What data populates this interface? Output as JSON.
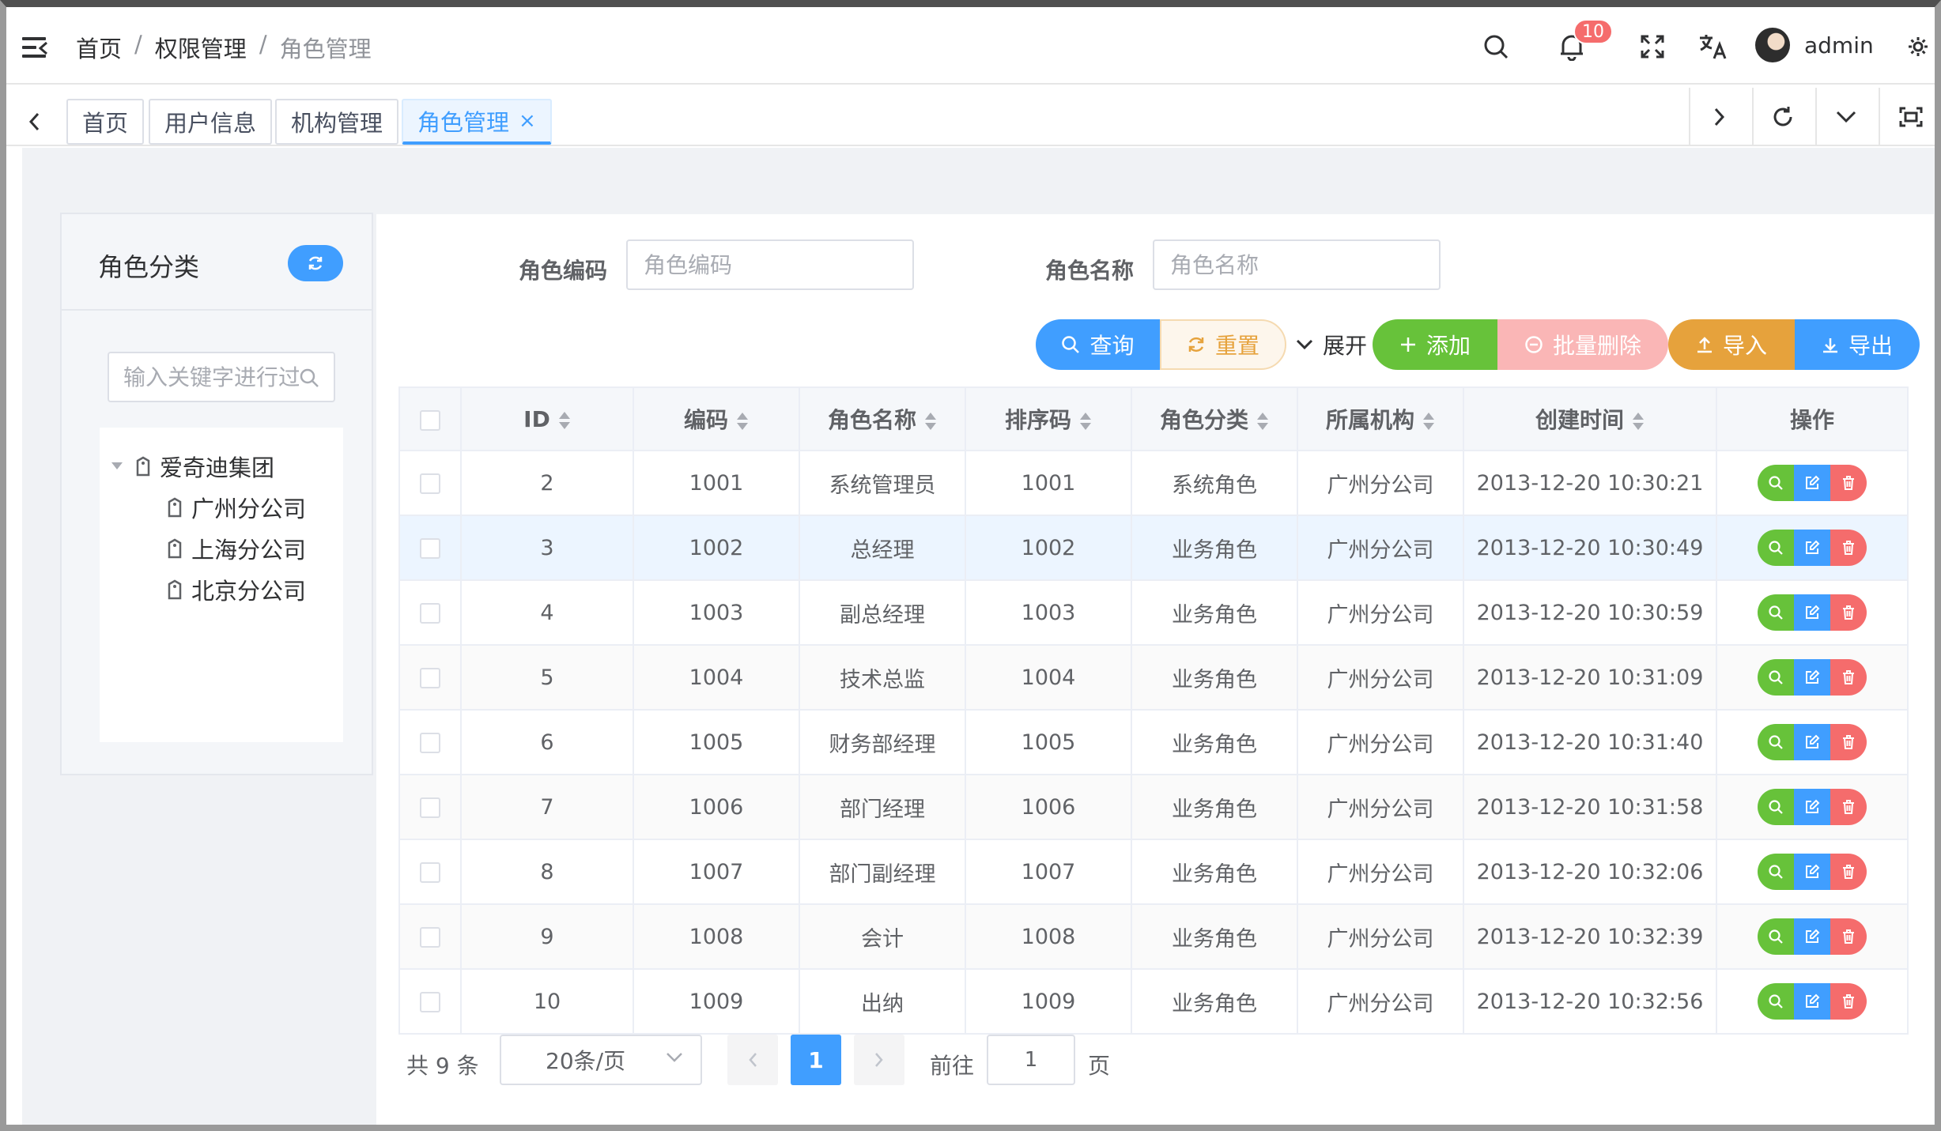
{
  "header": {
    "breadcrumb": [
      "首页",
      "权限管理",
      "角色管理"
    ],
    "breadcrumb_sep": "/",
    "notification_count": "10",
    "username": "admin"
  },
  "tags": [
    {
      "label": "首页",
      "active": false
    },
    {
      "label": "用户信息",
      "active": false
    },
    {
      "label": "机构管理",
      "active": false
    },
    {
      "label": "角色管理",
      "active": true
    }
  ],
  "tag_close": "×",
  "sidebar": {
    "title": "角色分类",
    "search_placeholder": "输入关键字进行过滤",
    "tree": {
      "root": "爱奇迪集团",
      "children": [
        "广州分公司",
        "上海分公司",
        "北京分公司"
      ]
    }
  },
  "filters": {
    "code_label": "角色编码",
    "code_placeholder": "角色编码",
    "name_label": "角色名称",
    "name_placeholder": "角色名称"
  },
  "toolbar": {
    "query": "查询",
    "reset": "重置",
    "expand": "展开",
    "add": "添加",
    "batch_delete": "批量删除",
    "import": "导入",
    "export": "导出"
  },
  "table": {
    "columns": [
      "ID",
      "编码",
      "角色名称",
      "排序码",
      "角色分类",
      "所属机构",
      "创建时间",
      "操作"
    ],
    "rows": [
      {
        "id": "2",
        "code": "1001",
        "name": "系统管理员",
        "sort": "1001",
        "category": "系统角色",
        "org": "广州分公司",
        "created": "2013-12-20 10:30:21"
      },
      {
        "id": "3",
        "code": "1002",
        "name": "总经理",
        "sort": "1002",
        "category": "业务角色",
        "org": "广州分公司",
        "created": "2013-12-20 10:30:49"
      },
      {
        "id": "4",
        "code": "1003",
        "name": "副总经理",
        "sort": "1003",
        "category": "业务角色",
        "org": "广州分公司",
        "created": "2013-12-20 10:30:59"
      },
      {
        "id": "5",
        "code": "1004",
        "name": "技术总监",
        "sort": "1004",
        "category": "业务角色",
        "org": "广州分公司",
        "created": "2013-12-20 10:31:09"
      },
      {
        "id": "6",
        "code": "1005",
        "name": "财务部经理",
        "sort": "1005",
        "category": "业务角色",
        "org": "广州分公司",
        "created": "2013-12-20 10:31:40"
      },
      {
        "id": "7",
        "code": "1006",
        "name": "部门经理",
        "sort": "1006",
        "category": "业务角色",
        "org": "广州分公司",
        "created": "2013-12-20 10:31:58"
      },
      {
        "id": "8",
        "code": "1007",
        "name": "部门副经理",
        "sort": "1007",
        "category": "业务角色",
        "org": "广州分公司",
        "created": "2013-12-20 10:32:06"
      },
      {
        "id": "9",
        "code": "1008",
        "name": "会计",
        "sort": "1008",
        "category": "业务角色",
        "org": "广州分公司",
        "created": "2013-12-20 10:32:39"
      },
      {
        "id": "10",
        "code": "1009",
        "name": "出纳",
        "sort": "1009",
        "category": "业务角色",
        "org": "广州分公司",
        "created": "2013-12-20 10:32:56"
      }
    ]
  },
  "pagination": {
    "total": "共 9 条",
    "page_size": "20条/页",
    "current_page": "1",
    "goto_label": "前往",
    "goto_value": "1",
    "page_suffix": "页"
  },
  "colors": {
    "primary": "#409eff",
    "success": "#67c23a",
    "warning": "#e6a23c",
    "danger": "#f56c6c",
    "danger_light": "#fab6b6"
  },
  "icons": [
    "hamburger-icon",
    "search-icon",
    "bell-icon",
    "fullscreen-icon",
    "translate-icon",
    "settings-icon",
    "refresh-icon",
    "chevron-left-icon",
    "chevron-right-icon",
    "chevron-down-icon",
    "maximize-icon",
    "tag-icon",
    "plus-icon",
    "upload-icon",
    "download-icon",
    "edit-icon",
    "trash-icon"
  ]
}
